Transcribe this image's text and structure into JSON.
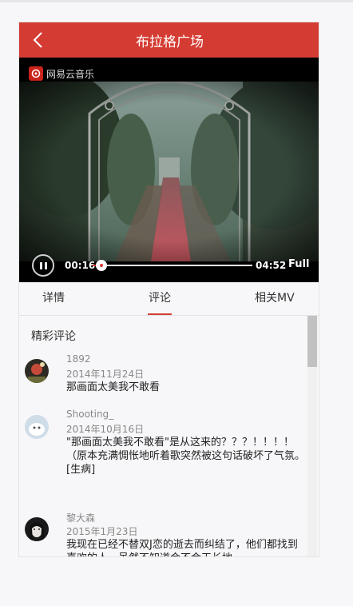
{
  "header": {
    "title": "布拉格广场"
  },
  "video": {
    "watermark": "网易云音乐",
    "current_time": "00:16",
    "total_time": "04:52",
    "progress": 0.055,
    "full_label": "Full"
  },
  "tabs": [
    {
      "label": "详情"
    },
    {
      "label": "评论",
      "active": true
    },
    {
      "label": "相关MV"
    }
  ],
  "comments": {
    "section_title": "精彩评论",
    "items": [
      {
        "user": "1892",
        "date": "2014年11月24日",
        "text": "那画面太美我不敢看"
      },
      {
        "user": "Shooting_",
        "date": "2014年10月16日",
        "text": "\"那画面太美我不敢看\"是从这来的？？？！！！！（原本充满惆怅地听着歌突然被这句话破坏了气氛。[生病]"
      },
      {
        "user": "黎大森",
        "date": "2015年1月23日",
        "text": "我现在已经不替双J恋的逝去而纠结了，他们都找到喜欢的人，虽然不知道会不会天长地"
      }
    ]
  },
  "colors": {
    "accent": "#d43c33",
    "background": "#f7f7f9"
  }
}
